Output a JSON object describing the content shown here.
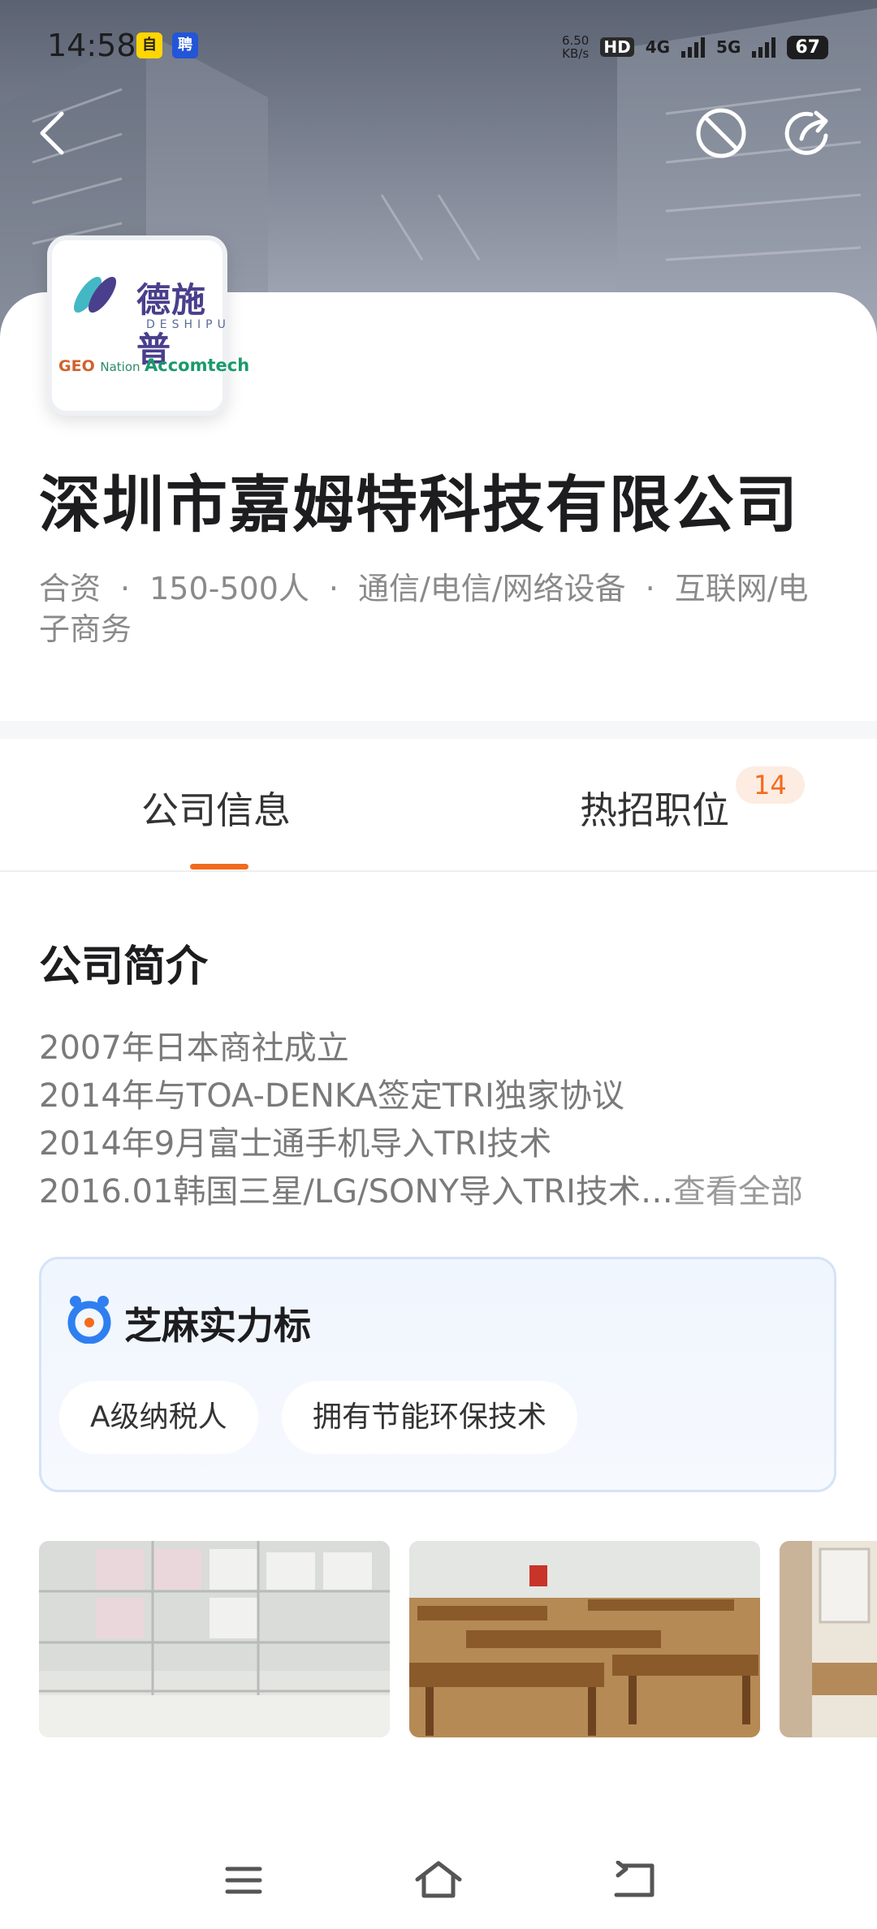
{
  "status_bar": {
    "time": "14:58",
    "badge1": "自",
    "badge2": "聘",
    "net_speed_value": "6.50",
    "net_speed_unit": "KB/s",
    "hd_label": "HD",
    "sig1_label": "4G",
    "sig2_label": "5G",
    "battery": "67"
  },
  "company": {
    "logo_cn": "德施普",
    "logo_en": "DESHIPU",
    "logo_geo": "GEO",
    "logo_geo_sub": "Nation",
    "logo_acc": "Accomtech",
    "name": "深圳市嘉姆特科技有限公司",
    "tags": [
      "合资",
      "150-500人",
      "通信/电信/网络设备",
      "互联网/电子商务"
    ],
    "tag_sep": "·"
  },
  "tabs": {
    "info": "公司信息",
    "jobs": "热招职位",
    "jobs_count": "14"
  },
  "intro": {
    "title": "公司简介",
    "lines": [
      "2007年日本商社成立",
      "2014年与TOA-DENKA签定TRI独家协议",
      "2014年9月富士通手机导入TRI技术",
      "2016.01韩国三星/LG/SONY导入TRI技术…"
    ],
    "more": "查看全部"
  },
  "zhima": {
    "title": "芝麻实力标",
    "pills": [
      "A级纳税人",
      "拥有节能环保技术"
    ]
  },
  "icons": {
    "back": "back-arrow-icon",
    "block": "block-icon",
    "share": "share-icon",
    "menu": "menu-icon",
    "home": "home-icon",
    "return": "return-icon"
  },
  "colors": {
    "accent": "#f26b1d",
    "badge_bg": "#fdece2",
    "zhima_border": "#d5e3f7",
    "zhima_icon": "#2f7ff0"
  }
}
